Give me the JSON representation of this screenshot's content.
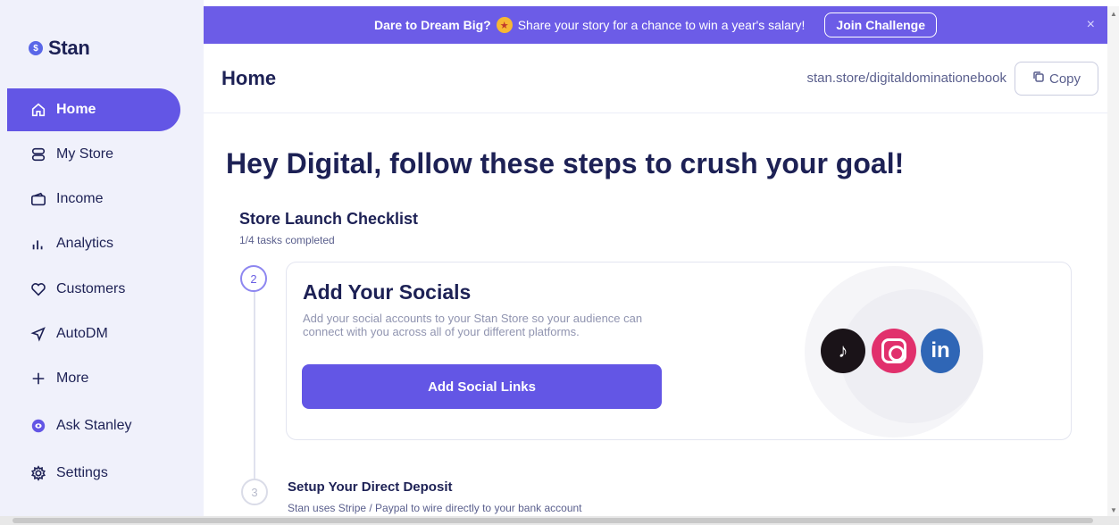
{
  "brand": {
    "name": "Stan",
    "logo_glyph": "$"
  },
  "sidebar": {
    "items": [
      {
        "label": "Home",
        "icon": "home-icon",
        "active": true
      },
      {
        "label": "My Store",
        "icon": "store-icon",
        "active": false
      },
      {
        "label": "Income",
        "icon": "wallet-icon",
        "active": false
      },
      {
        "label": "Analytics",
        "icon": "analytics-icon",
        "active": false
      },
      {
        "label": "Customers",
        "icon": "heart-icon",
        "active": false
      },
      {
        "label": "AutoDM",
        "icon": "send-icon",
        "active": false
      },
      {
        "label": "More",
        "icon": "plus-icon",
        "active": false
      },
      {
        "label": "Ask Stanley",
        "icon": "stanley-icon",
        "active": false
      },
      {
        "label": "Settings",
        "icon": "gear-icon",
        "active": false
      }
    ]
  },
  "banner": {
    "headline": "Dare to Dream Big?",
    "message": "Share your story for a chance to win a year's salary!",
    "cta": "Join Challenge",
    "close": "×"
  },
  "header": {
    "title": "Home",
    "store_url": "stan.store/digitaldominationebook",
    "copy_label": "Copy"
  },
  "main": {
    "greeting": "Hey Digital, follow these steps to crush your goal!",
    "checklist": {
      "title": "Store Launch Checklist",
      "progress": "1/4 tasks completed",
      "steps": [
        {
          "number": "2",
          "title": "Add Your Socials",
          "description": "Add your social accounts to your Stan Store so your audience can connect with you across all of your different platforms.",
          "button": "Add Social Links",
          "socials": [
            "tiktok-icon",
            "instagram-icon",
            "linkedin-icon"
          ]
        },
        {
          "number": "3",
          "title": "Setup Your Direct Deposit",
          "description": "Stan uses Stripe / Paypal to wire directly to your bank account"
        }
      ]
    }
  },
  "colors": {
    "accent": "#6356e5",
    "banner": "#6c5ce7",
    "sidebar_bg": "#f0f1fb",
    "text_dark": "#1d2155"
  }
}
